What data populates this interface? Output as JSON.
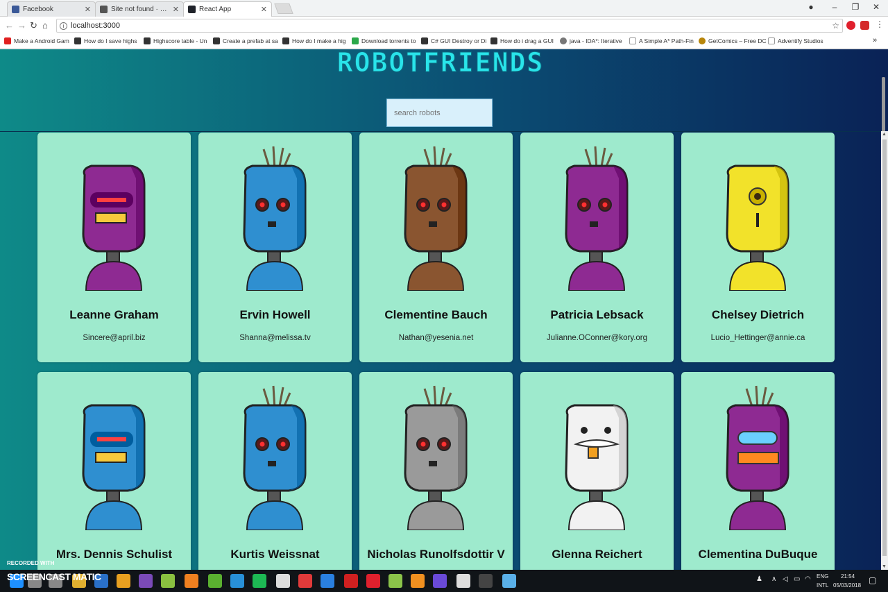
{
  "browser": {
    "tabs": [
      {
        "title": "Facebook",
        "color": "#3b5998"
      },
      {
        "title": "Site not found · GitHub P",
        "color": "#555555"
      },
      {
        "title": "React App",
        "color": "#20232a"
      }
    ],
    "url": "localhost:3000",
    "bookmarks": [
      {
        "label": "Make a Android Gam",
        "color": "#e02020"
      },
      {
        "label": "How do I save highs",
        "color": "#333333"
      },
      {
        "label": "Highscore table - Un",
        "color": "#333333"
      },
      {
        "label": "Create a prefab at sa",
        "color": "#333333"
      },
      {
        "label": "How do I make a hig",
        "color": "#333333"
      },
      {
        "label": "Download torrents to",
        "color": "#2ba84a"
      },
      {
        "label": "C# GUI Destroy or Di",
        "color": "#333333"
      },
      {
        "label": "How do i drag a GUI",
        "color": "#333333"
      },
      {
        "label": "java - IDA*: Iterative",
        "color": "#777777"
      },
      {
        "label": "A Simple A* Path-Fin",
        "color": "#999999"
      },
      {
        "label": "GetComics – Free DC",
        "color": "#b8860b"
      },
      {
        "label": "Adventify Studios",
        "color": "#999999"
      }
    ]
  },
  "app": {
    "title": "ROBOTFRIENDS",
    "search_placeholder": "search robots",
    "robots": [
      {
        "name": "Leanne Graham",
        "email": "Sincere@april.biz",
        "color": "#8e2a92",
        "style": "visor"
      },
      {
        "name": "Ervin Howell",
        "email": "Shanna@melissa.tv",
        "color": "#2f8fd0",
        "style": "hair"
      },
      {
        "name": "Clementine Bauch",
        "email": "Nathan@yesenia.net",
        "color": "#8a5530",
        "style": "hair"
      },
      {
        "name": "Patricia Lebsack",
        "email": "Julianne.OConner@kory.org",
        "color": "#8e2a92",
        "style": "hair"
      },
      {
        "name": "Chelsey Dietrich",
        "email": "Lucio_Hettinger@annie.ca",
        "color": "#f2e22a",
        "style": "cyclops"
      },
      {
        "name": "Mrs. Dennis Schulist",
        "email": "",
        "color": "#2f8fd0",
        "style": "visor"
      },
      {
        "name": "Kurtis Weissnat",
        "email": "",
        "color": "#2f8fd0",
        "style": "hair"
      },
      {
        "name": "Nicholas Runolfsdottir V",
        "email": "",
        "color": "#9a9a9a",
        "style": "hair"
      },
      {
        "name": "Glenna Reichert",
        "email": "",
        "color": "#f2f2f2",
        "style": "mustache"
      },
      {
        "name": "Clementina DuBuque",
        "email": "",
        "color": "#8e2a92",
        "style": "hairvisor"
      }
    ]
  },
  "watermark": {
    "line1": "RECORDED WITH",
    "line2": "SCREENCAST MATIC"
  },
  "taskbar": {
    "language": "ENG",
    "layout": "INTL",
    "time": "21:54",
    "date": "05/03/2018"
  }
}
